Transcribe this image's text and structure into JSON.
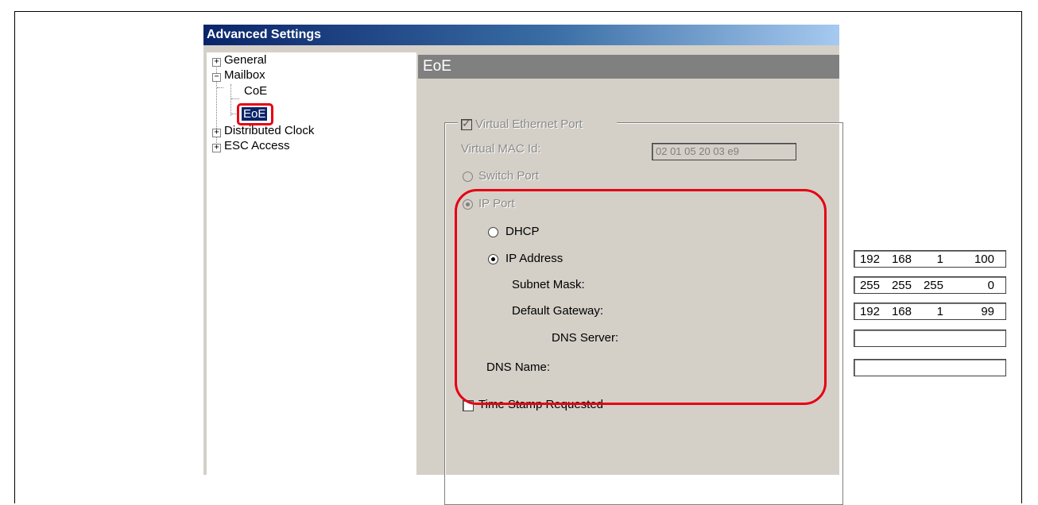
{
  "window": {
    "title": "Advanced Settings"
  },
  "tree": {
    "items": [
      {
        "label": "General",
        "expander": "+"
      },
      {
        "label": "Mailbox",
        "expander": "−"
      },
      {
        "label": "CoE"
      },
      {
        "label": "EoE",
        "selected": true
      },
      {
        "label": "Distributed Clock",
        "expander": "+"
      },
      {
        "label": "ESC Access",
        "expander": "+"
      }
    ]
  },
  "pane": {
    "title": "EoE",
    "virtual_ethernet_port": {
      "label": "Virtual Ethernet Port",
      "checked": true,
      "enabled": false
    },
    "virtual_mac": {
      "label": "Virtual MAC Id:",
      "value": "02 01 05 20 03 e9"
    },
    "switch_port": {
      "label": "Switch Port",
      "selected": false
    },
    "ip_port": {
      "label": "IP Port",
      "selected": true
    },
    "dhcp": {
      "label": "DHCP",
      "selected": false
    },
    "ip_address": {
      "label": "IP Address",
      "selected": true,
      "octets": [
        "192",
        "168",
        "1",
        "100"
      ]
    },
    "subnet_mask": {
      "label": "Subnet Mask:",
      "octets": [
        "255",
        "255",
        "255",
        "0"
      ]
    },
    "default_gateway": {
      "label": "Default Gateway:",
      "octets": [
        "192",
        "168",
        "1",
        "99"
      ]
    },
    "dns_server": {
      "label": "DNS Server:",
      "value": ""
    },
    "dns_name": {
      "label": "DNS Name:",
      "value": ""
    },
    "time_stamp": {
      "label": "Time Stamp Requested",
      "checked": false
    }
  },
  "colors": {
    "highlight": "#e60012",
    "selection": "#0a246a",
    "dialog_bg": "#d4d0c8"
  }
}
